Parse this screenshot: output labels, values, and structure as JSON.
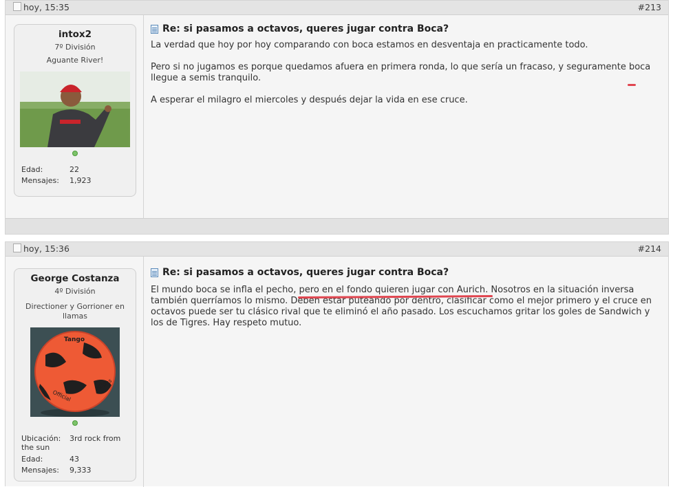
{
  "posts": [
    {
      "date": "hoy, 15:35",
      "number": "#213",
      "user": {
        "name": "intox2",
        "rank": "7º División",
        "title": "Aguante River!",
        "stats": [
          {
            "label": "Edad:",
            "value": "22"
          },
          {
            "label": "Mensajes:",
            "value": "1,923"
          }
        ]
      },
      "title": "Re: si pasamos a octavos, queres jugar contra Boca?",
      "paragraphs": [
        {
          "text": "La verdad que hoy por hoy comparando con boca estamos en desventaja en practicamente todo."
        },
        {
          "text_before": "Pero si no jugamos es porque quedamos afuera en primera ronda, lo que sería un fracaso, y seguramente ",
          "text_highlight": "boca llegue a semis tranquilo."
        },
        {
          "text": "A esperar el milagro el miercoles y después dejar la vida en ese cruce."
        }
      ]
    },
    {
      "date": "hoy, 15:36",
      "number": "#214",
      "user": {
        "name": "George Costanza",
        "rank": "4º División",
        "title": "Directioner y Gorrioner en llamas",
        "stats": [
          {
            "label": "Ubicación:",
            "value": "3rd rock from the sun"
          },
          {
            "label": "Edad:",
            "value": "43"
          },
          {
            "label": "Mensajes:",
            "value": "9,333"
          }
        ]
      },
      "title": "Re: si pasamos a octavos, queres jugar contra Boca?",
      "paragraph": {
        "text_before": "El mundo boca se infla el pecho, ",
        "text_highlight": "pero en el fondo quieren jugar con Aurich",
        "text_after": ". Nosotros en la situación inversa también querríamos lo mismo. Deben estar puteando por dentro, clasificar como el mejor primero y el cruce en octavos puede ser tu clásico rival que te eliminó el año pasado. Los escuchamos gritar los goles de Sandwich y los de Tigres. Hay respeto mutuo."
      }
    }
  ],
  "colors": {
    "highlight_underline": "#e0454f",
    "header_bar": "#e4e4e4",
    "post_bg": "#f5f5f5"
  },
  "icons": [
    "checkbox-icon",
    "document-icon",
    "online-status-icon"
  ]
}
